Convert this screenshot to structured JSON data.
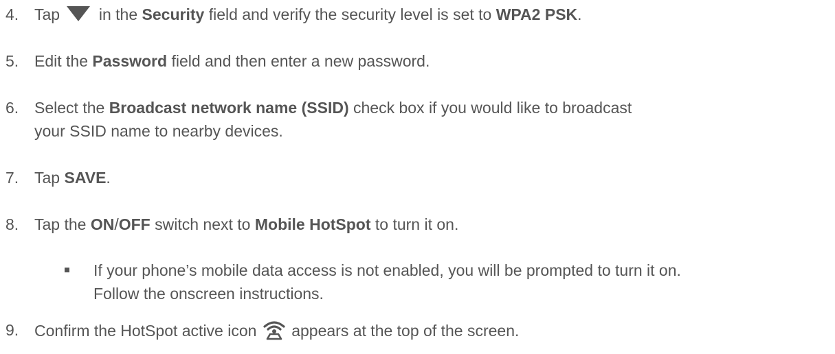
{
  "steps": [
    {
      "number": "4.",
      "parts": {
        "a": "Tap",
        "icon": "dropdown-triangle-icon",
        "b": "in the",
        "c": "Security",
        "d": "field and verify the security level is set to",
        "e": "WPA2 PSK",
        "f": "."
      }
    },
    {
      "number": "5.",
      "parts": {
        "a": "Edit the",
        "b": "Password",
        "c": "field and then enter a new password."
      }
    },
    {
      "number": "6.",
      "parts": {
        "a": "Select the",
        "b": "Broadcast network name (SSID)",
        "c": "check box if you would like to broadcast",
        "d": "your SSID name to nearby devices."
      }
    },
    {
      "number": "7.",
      "parts": {
        "a": "Tap",
        "b": "SAVE",
        "c": "."
      }
    },
    {
      "number": "8.",
      "parts": {
        "a": "Tap the",
        "b": "ON",
        "c": "/",
        "d": "OFF",
        "e": "switch next to",
        "f": "Mobile HotSpot",
        "g": "to turn it on."
      }
    },
    {
      "number": "9.",
      "parts": {
        "a": "Confirm the HotSpot active icon",
        "icon": "hotspot-active-icon",
        "b": "appears at the top of the screen."
      }
    }
  ],
  "step8_bullet": {
    "line1": "If your phone’s mobile data access is not enabled, you will be prompted to turn it on.",
    "line2": "Follow the onscreen instructions."
  },
  "colors": {
    "text": "#555555",
    "background": "#ffffff"
  }
}
